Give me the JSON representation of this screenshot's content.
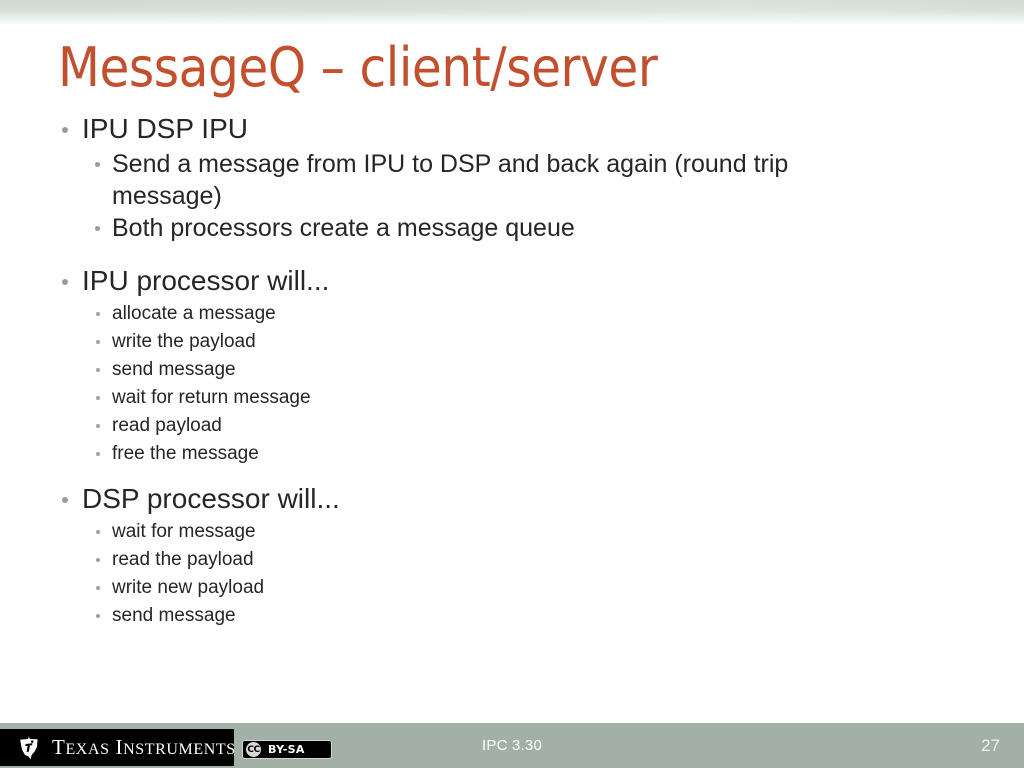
{
  "slide": {
    "title": "MessageQ – client/server",
    "title_color": "#c2502f",
    "body_color": "#262626",
    "background": "#ffffff"
  },
  "content": {
    "sections": [
      {
        "heading": "IPU  DSP  IPU",
        "heading_parts": [
          "IPU",
          "→",
          "DSP",
          "→",
          "IPU"
        ],
        "items": [
          "Send a message from IPU to DSP and back again (round trip message)",
          "Both processors create a message queue"
        ]
      },
      {
        "heading": "IPU processor will...",
        "items": [
          "allocate a message",
          "write the payload",
          "send message",
          "wait for return message",
          "read payload",
          "free the message"
        ]
      },
      {
        "heading": "DSP processor will...",
        "items": [
          "wait for message",
          "read the payload",
          "write new payload",
          "send message"
        ]
      }
    ]
  },
  "footer": {
    "bar_color": "#a3b0a7",
    "center_text": "IPC 3.30",
    "page_number": "27",
    "logo": {
      "wordmark_first": "T",
      "wordmark_first_rest": "EXAS",
      "wordmark_second": "I",
      "wordmark_second_rest": "NSTRUMENTS",
      "star_icon": "texas-star-ti-icon"
    },
    "license": {
      "mark": "CC",
      "terms": "BY-SA"
    }
  }
}
